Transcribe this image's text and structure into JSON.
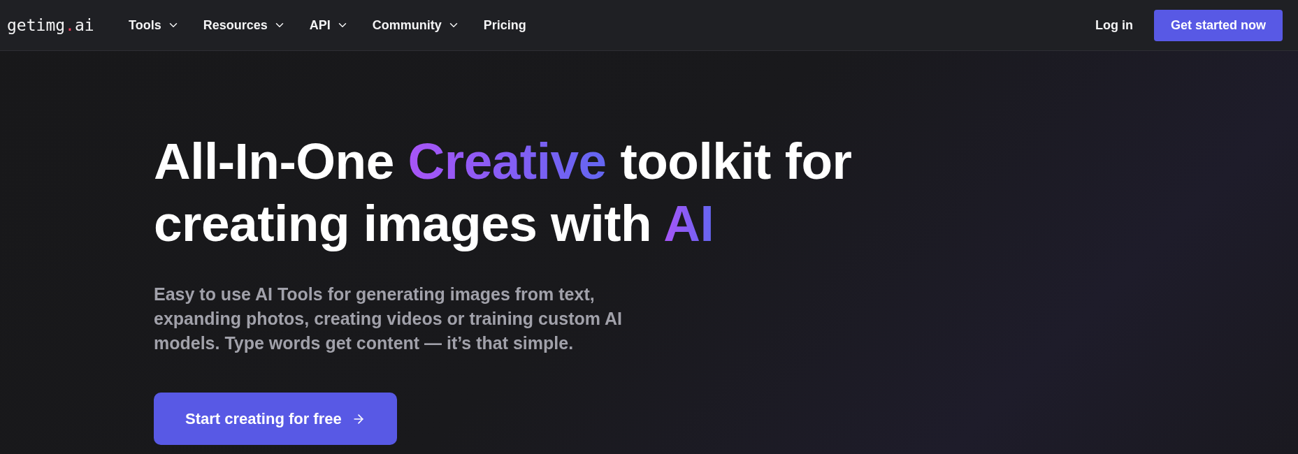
{
  "logo": [
    {
      "text": "getimg",
      "accent": false
    },
    {
      "text": ".",
      "accent": true
    },
    {
      "text": "ai",
      "accent": false
    }
  ],
  "nav": [
    {
      "label": "Tools",
      "has_menu": true
    },
    {
      "label": "Resources",
      "has_menu": true
    },
    {
      "label": "API",
      "has_menu": true
    },
    {
      "label": "Community",
      "has_menu": true
    },
    {
      "label": "Pricing",
      "has_menu": false
    }
  ],
  "login": "Log in",
  "cta_top": "Get started now",
  "headline": [
    [
      {
        "text": "All-In-One ",
        "highlight": false
      },
      {
        "text": "Creative",
        "highlight": true
      },
      {
        "text": " toolkit for",
        "highlight": false
      }
    ],
    [
      {
        "text": "creating images with ",
        "highlight": false
      },
      {
        "text": "AI",
        "highlight": true
      }
    ]
  ],
  "subtitle": "Easy to use AI Tools for generating images from text, expanding photos, creating videos or training custom AI models. Type words get content — it’s that simple.",
  "cta_main": {
    "label": "Start creating for free",
    "arrow": true
  }
}
